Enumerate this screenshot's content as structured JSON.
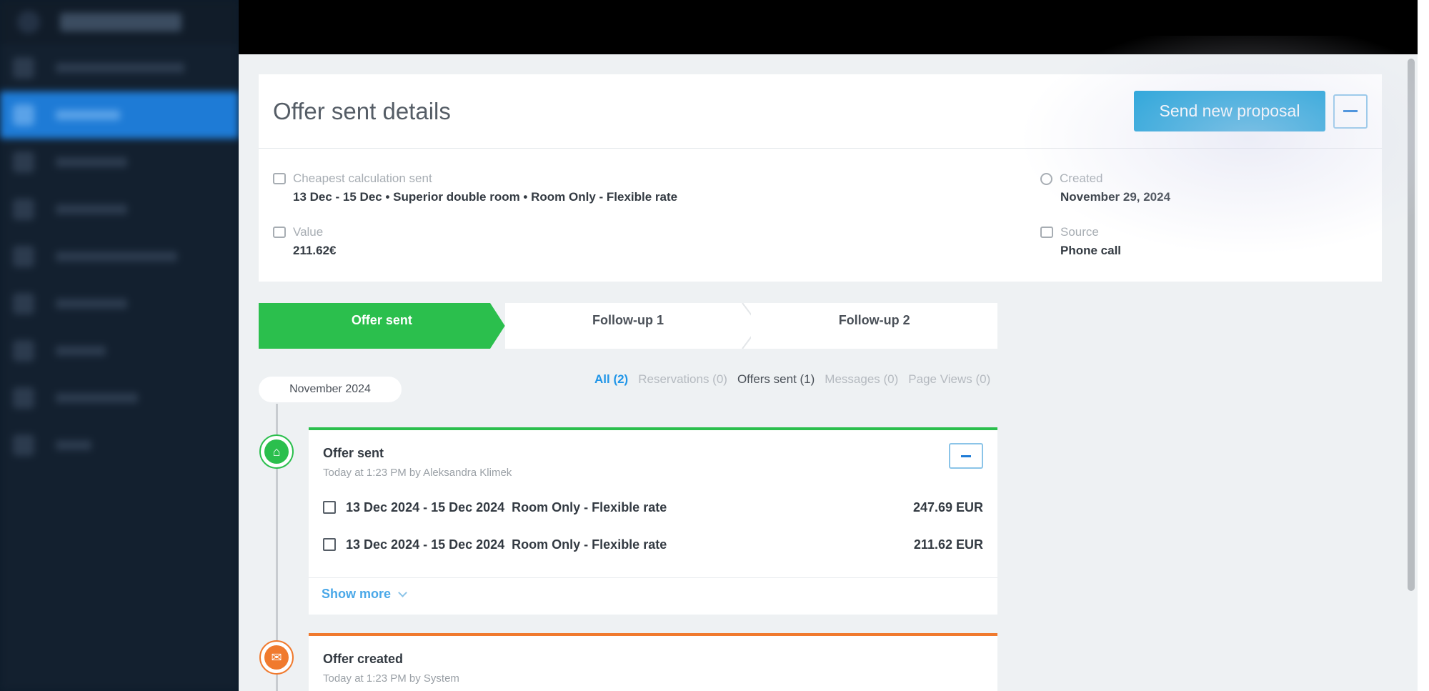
{
  "details": {
    "title": "Offer sent details",
    "send_button": "Send new proposal",
    "cheapest_label": "Cheapest calculation sent",
    "cheapest_value": "13 Dec - 15 Dec • Superior double room • Room Only - Flexible rate",
    "value_label": "Value",
    "value_value": "211.62€",
    "created_label": "Created",
    "created_value": "November 29, 2024",
    "source_label": "Source",
    "source_value": "Phone call"
  },
  "steps": [
    {
      "label": "Offer sent",
      "status": "done"
    },
    {
      "label": "Follow-up 1",
      "status": "pending"
    },
    {
      "label": "Follow-up 2",
      "status": "pending"
    }
  ],
  "timeline": {
    "month": "November 2024",
    "filters": [
      {
        "label": "All (2)",
        "state": "active"
      },
      {
        "label": "Reservations (0)",
        "state": "disabled"
      },
      {
        "label": "Offers sent (1)",
        "state": "normal"
      },
      {
        "label": "Messages (0)",
        "state": "disabled"
      },
      {
        "label": "Page Views (0)",
        "state": "disabled"
      }
    ],
    "events": [
      {
        "title": "Offer sent",
        "subtitle": "Today at 1:23 PM by Aleksandra Klimek",
        "rows": [
          {
            "dates": "13 Dec 2024 - 15 Dec 2024",
            "rate": "Room Only - Flexible rate",
            "price": "247.69 EUR"
          },
          {
            "dates": "13 Dec 2024 - 15 Dec 2024",
            "rate": "Room Only - Flexible rate",
            "price": "211.62 EUR"
          }
        ],
        "show_more": "Show more"
      },
      {
        "title": "Offer created",
        "subtitle": "Today at 1:23 PM by System"
      }
    ]
  },
  "colors": {
    "accent": "#0a9bd6",
    "success": "#2bbf4d",
    "warning": "#f07a2e",
    "sidebar_active": "#1e7bd6"
  }
}
